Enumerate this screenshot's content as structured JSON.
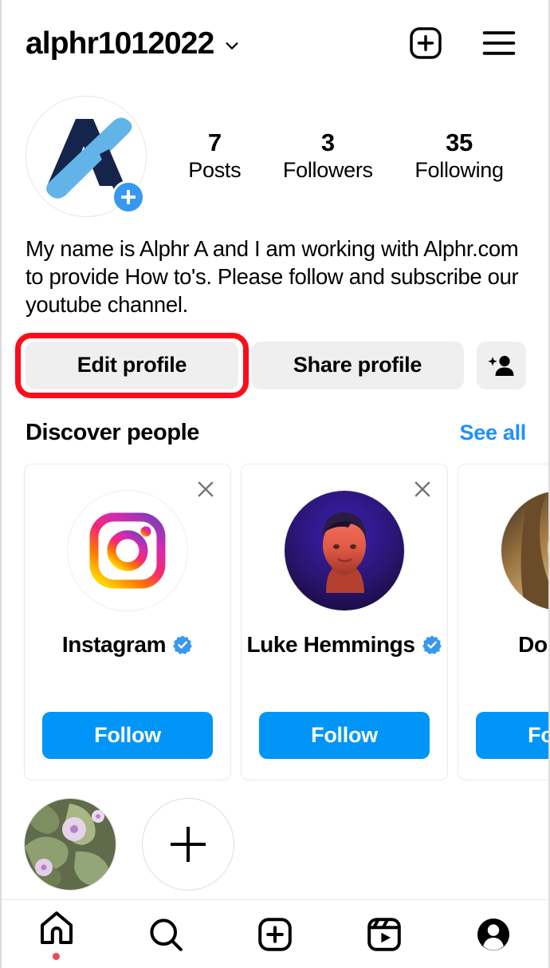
{
  "header": {
    "username": "alphr1012022",
    "chevron_icon": "chevron-down-icon",
    "create_icon": "plus-square-icon",
    "menu_icon": "hamburger-menu-icon"
  },
  "profile": {
    "avatar_icon": "alphr-logo-avatar",
    "avatar_add_badge": "plus-badge-icon",
    "stats": [
      {
        "value": "7",
        "label": "Posts"
      },
      {
        "value": "3",
        "label": "Followers"
      },
      {
        "value": "35",
        "label": "Following"
      }
    ],
    "bio": "My name is Alphr A and I am working with Alphr.com to provide How to's. Please follow and subscribe our youtube channel."
  },
  "actions": {
    "edit_profile": "Edit profile",
    "share_profile": "Share profile",
    "add_person_icon": "add-person-icon",
    "highlight_color": "#fc0d1b"
  },
  "discover": {
    "title": "Discover people",
    "see_all": "See all",
    "cards": [
      {
        "name": "Instagram",
        "verified": true,
        "follow_label": "Follow",
        "close_icon": "close-icon",
        "avatar_icon": "instagram-logo-avatar"
      },
      {
        "name": "Luke Hemmings",
        "verified": true,
        "follow_label": "Follow",
        "close_icon": "close-icon",
        "avatar_icon": "portrait-avatar-red-blue"
      },
      {
        "name": "Doutzen",
        "verified": false,
        "follow_label": "Follow",
        "close_icon": "close-icon",
        "avatar_icon": "portrait-avatar-blonde"
      }
    ]
  },
  "highlights": [
    {
      "name": "story-highlight-flowers",
      "type": "image"
    },
    {
      "name": "new-highlight",
      "type": "add"
    }
  ],
  "bottom_nav": [
    {
      "icon": "home-icon",
      "active": true,
      "badge": true
    },
    {
      "icon": "search-icon",
      "active": false,
      "badge": false
    },
    {
      "icon": "create-icon",
      "active": false,
      "badge": false
    },
    {
      "icon": "reels-icon",
      "active": false,
      "badge": false
    },
    {
      "icon": "profile-icon",
      "active": false,
      "badge": false
    }
  ],
  "colors": {
    "accent_blue": "#0095f6",
    "link_blue": "#1f90ff",
    "grey_button": "#efefef",
    "verified_blue": "#3897f0",
    "notification_red": "#ed4956"
  }
}
